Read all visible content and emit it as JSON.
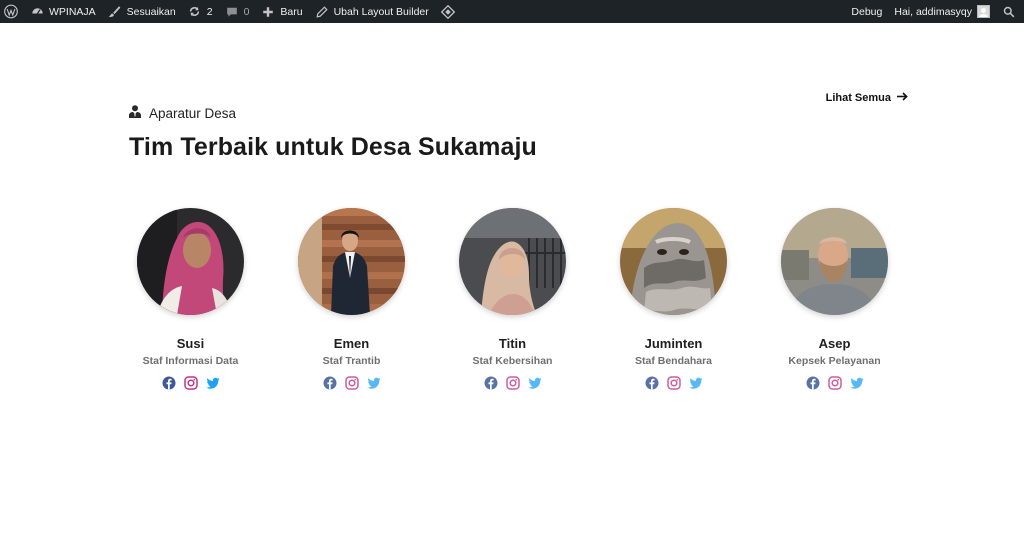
{
  "adminbar": {
    "site_name": "WPINAJA",
    "customize": "Sesuaikan",
    "updates_count": "2",
    "comments_count": "0",
    "new_label": "Baru",
    "layout_builder": "Ubah Layout Builder",
    "debug": "Debug",
    "greeting": "Hai, addimasyqy"
  },
  "section": {
    "eyebrow": "Aparatur Desa",
    "heading": "Tim Terbaik untuk Desa Sukamaju",
    "see_all": "Lihat Semua"
  },
  "team": [
    {
      "name": "Susi",
      "role": "Staf Informasi Data"
    },
    {
      "name": "Emen",
      "role": "Staf Trantib"
    },
    {
      "name": "Titin",
      "role": "Staf Kebersihan"
    },
    {
      "name": "Juminten",
      "role": "Staf Bendahara"
    },
    {
      "name": "Asep",
      "role": "Kepsek Pelayanan"
    }
  ],
  "colors": {
    "adminbar_bg": "#1d2327",
    "facebook": "#3b5998",
    "instagram": "#c13584",
    "twitter": "#1da1f2"
  }
}
